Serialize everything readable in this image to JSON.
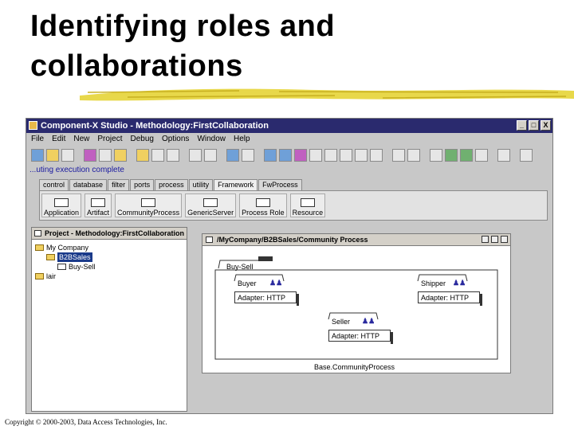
{
  "slide": {
    "title_line1": "Identifying roles and",
    "title_line2": "collaborations",
    "copyright": "Copyright © 2000-2003, Data Access Technologies, Inc."
  },
  "window": {
    "title": "Component-X Studio - Methodology:FirstCollaboration",
    "controls": [
      "_",
      "□",
      "X"
    ]
  },
  "menu": [
    "File",
    "Edit",
    "New",
    "Project",
    "Debug",
    "Options",
    "Window",
    "Help"
  ],
  "status_text": "...uting execution complete",
  "tabs": [
    "control",
    "database",
    "filter",
    "ports",
    "process",
    "utility",
    "Framework",
    "FwProcess"
  ],
  "active_tab": "Framework",
  "palette": [
    "Application",
    "Artifact",
    "CommunityProcess",
    "GenericServer",
    "Process Role",
    "Resource"
  ],
  "project": {
    "title": "Project - Methodology:FirstCollaboration",
    "tree": {
      "root": "My Company",
      "child": "B2BSales",
      "grandchild": "Buy-Sell",
      "other": "lair"
    }
  },
  "diagram": {
    "title": "/MyCompany/B2BSales/Community Process",
    "container_label": "Buy-Sell",
    "roles": {
      "buyer": "Buyer",
      "shipper": "Shipper",
      "seller": "Seller"
    },
    "adapter_label": "Adapter: HTTP",
    "footer": "Base.CommunityProcess"
  }
}
